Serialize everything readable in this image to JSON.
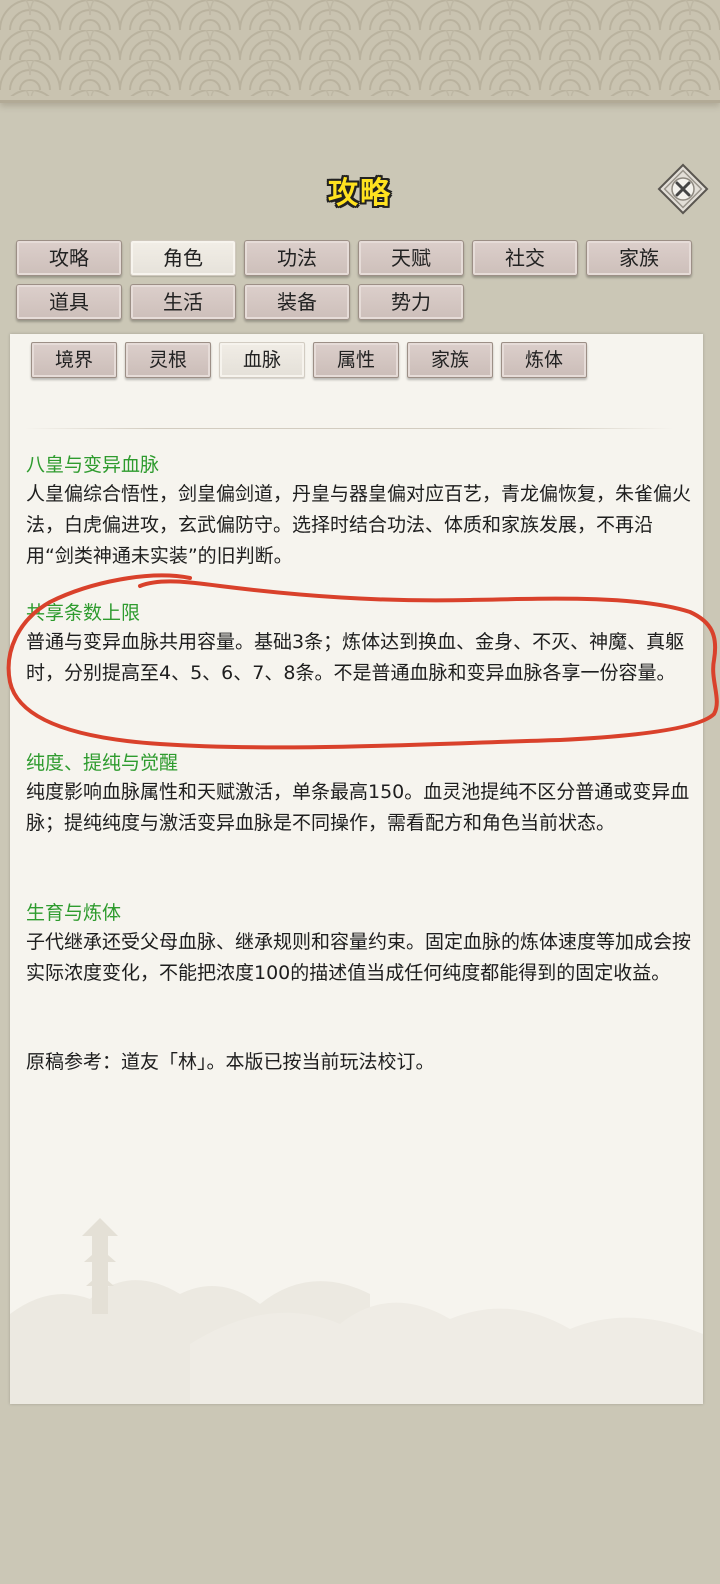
{
  "title": "攻略",
  "main_tabs": [
    {
      "label": "攻略"
    },
    {
      "label": "角色"
    },
    {
      "label": "功法"
    },
    {
      "label": "天赋"
    },
    {
      "label": "社交"
    },
    {
      "label": "家族"
    },
    {
      "label": "道具"
    },
    {
      "label": "生活"
    },
    {
      "label": "装备"
    },
    {
      "label": "势力"
    }
  ],
  "main_tab_active": "角色",
  "sub_tabs": [
    {
      "label": "境界"
    },
    {
      "label": "灵根"
    },
    {
      "label": "血脉"
    },
    {
      "label": "属性"
    },
    {
      "label": "家族"
    },
    {
      "label": "炼体"
    }
  ],
  "sub_tab_active": "血脉",
  "sections": [
    {
      "title": "八皇与变异血脉",
      "body": "人皇偏综合悟性，剑皇偏剑道，丹皇与器皇偏对应百艺，青龙偏恢复，朱雀偏火法，白虎偏进攻，玄武偏防守。选择时结合功法、体质和家族发展，不再沿用“剑类神通未实装”的旧判断。"
    },
    {
      "title": "共享条数上限",
      "body": "普通与变异血脉共用容量。基础3条；炼体达到换血、金身、不灭、神魔、真躯时，分别提高至4、5、6、7、8条。不是普通血脉和变异血脉各享一份容量。"
    },
    {
      "title": "纯度、提纯与觉醒",
      "body": "纯度影响血脉属性和天赋激活，单条最高150。血灵池提纯不区分普通或变异血脉；提纯纯度与激活变异血脉是不同操作，需看配方和角色当前状态。"
    },
    {
      "title": "生育与炼体",
      "body": "子代继承还受父母血脉、继承规则和容量约束。固定血脉的炼体速度等加成会按实际浓度变化，不能把浓度100的描述值当成任何纯度都能得到的固定收益。"
    }
  ],
  "reference": "原稿参考：道友「林」。本版已按当前玩法校订。",
  "colors": {
    "title_yellow": "#ffe21f",
    "section_green": "#2e9b2e",
    "annotation_red": "#d9412b"
  }
}
